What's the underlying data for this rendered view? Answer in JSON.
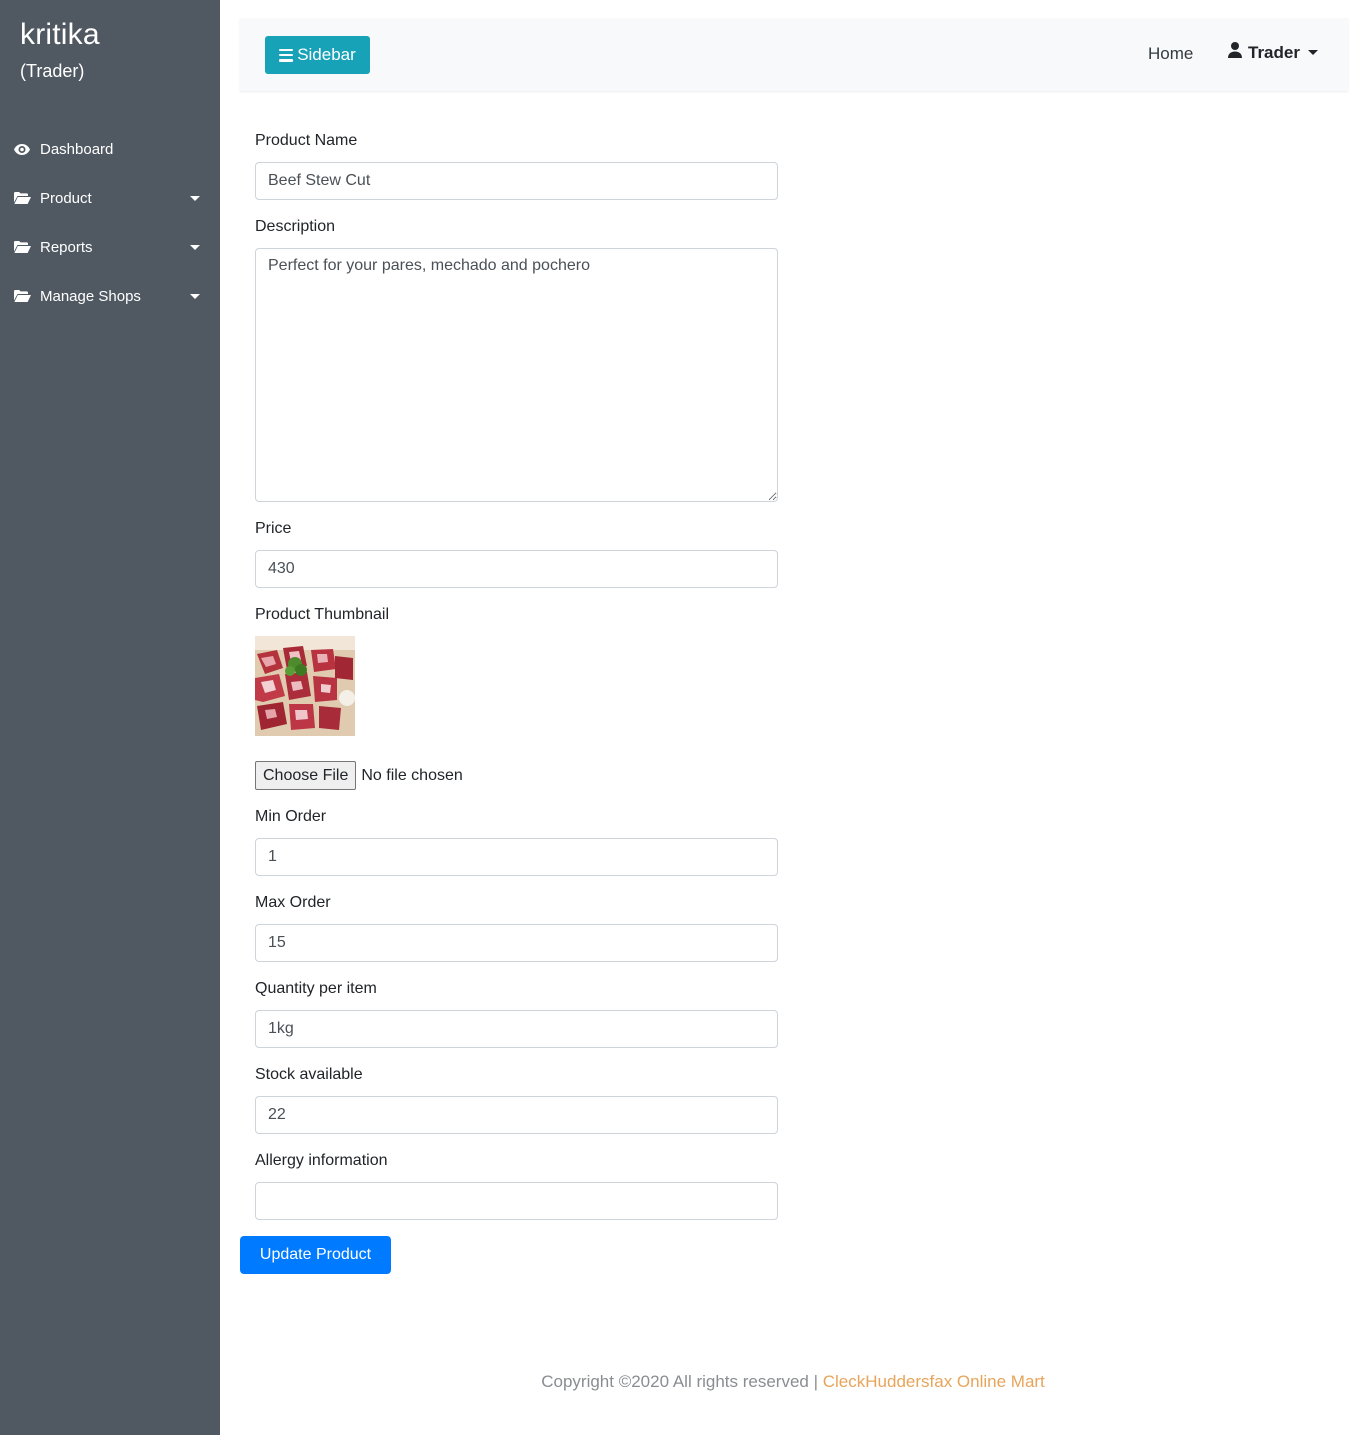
{
  "sidebar": {
    "brand_name": "kritika",
    "brand_role": "(Trader)",
    "items": [
      {
        "label": "Dashboard",
        "icon": "eye-icon",
        "has_caret": false
      },
      {
        "label": "Product",
        "icon": "folder-open-icon",
        "has_caret": true
      },
      {
        "label": "Reports",
        "icon": "folder-open-icon",
        "has_caret": true
      },
      {
        "label": "Manage Shops",
        "icon": "folder-open-icon",
        "has_caret": true
      }
    ],
    "bg_color": "#505962"
  },
  "topbar": {
    "sidebar_button_label": "Sidebar",
    "home_label": "Home",
    "user_label": "Trader",
    "button_color": "#17a2b8"
  },
  "form": {
    "product_name": {
      "label": "Product Name",
      "value": "Beef Stew Cut"
    },
    "description": {
      "label": "Description",
      "value": "Perfect for your pares, mechado and pochero"
    },
    "price": {
      "label": "Price",
      "value": "430"
    },
    "thumbnail": {
      "label": "Product Thumbnail",
      "image": "beef-cubes-thumbnail"
    },
    "file": {
      "button_label": "Choose File",
      "status": "No file chosen"
    },
    "min_order": {
      "label": "Min Order",
      "value": "1"
    },
    "max_order": {
      "label": "Max Order",
      "value": "15"
    },
    "quantity": {
      "label": "Quantity per item",
      "value": "1kg"
    },
    "stock": {
      "label": "Stock available",
      "value": "22"
    },
    "allergy": {
      "label": "Allergy information",
      "value": ""
    },
    "submit_label": "Update Product",
    "submit_color": "#007bff"
  },
  "footer": {
    "copyright": "Copyright ©2020 All rights reserved | ",
    "brand": "CleckHuddersfax Online Mart",
    "brand_color": "#e8a55a"
  }
}
